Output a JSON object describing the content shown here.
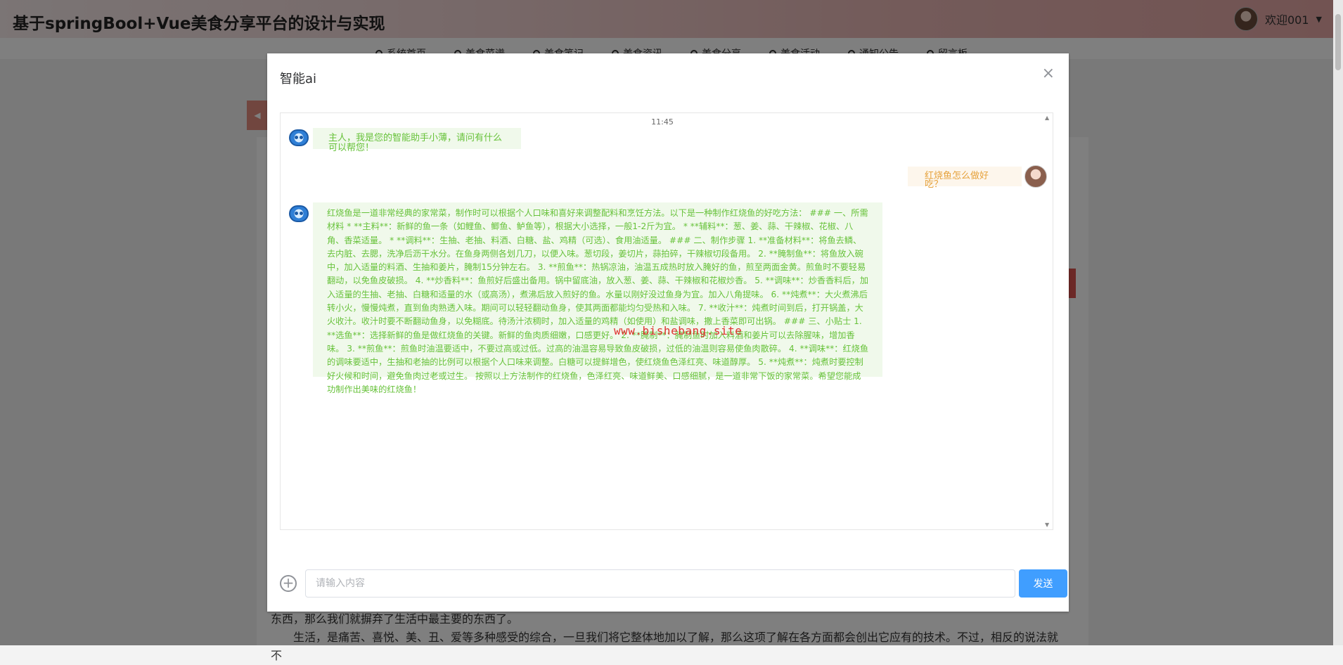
{
  "header": {
    "site_title": "基于springBool+Vue美食分享平台的设计与实现",
    "welcome": "欢迎001",
    "caret": "▼"
  },
  "nav": {
    "items": [
      "系统首页",
      "美食菜谱",
      "美食笔记",
      "美食资讯",
      "美食分享",
      "美食活动",
      "通知公告",
      "留言板"
    ]
  },
  "article": {
    "lines": [
      "东西，那么我们就摒弃了生活中最主要的东西了。",
      "生活，是痛苦、喜悦、美、丑、爱等多种感受的综合，一旦我们将它整体地加以了解，那么这项了解在各方面都会创出它应有的技术。不过，相反的说法就不"
    ]
  },
  "dialog": {
    "title": "智能ai",
    "close_glyph": "×",
    "timestamp": "11:45",
    "messages": [
      {
        "role": "bot",
        "text": "主人，我是您的智能助手小薄，请问有什么可以帮您！"
      },
      {
        "role": "user",
        "text": "红烧鱼怎么做好吃？"
      },
      {
        "role": "bot",
        "text": "红烧鱼是一道非常经典的家常菜，制作时可以根据个人口味和喜好来调整配料和烹饪方法。以下是一种制作红烧鱼的好吃方法： ### 一、所需材料 * **主料**：新鲜的鱼一条（如鲤鱼、鲫鱼、鲈鱼等），根据大小选择，一般1-2斤为宜。 * **辅料**：葱、姜、蒜、干辣椒、花椒、八角、香菜适量。 * **调料**：生抽、老抽、料酒、白糖、盐、鸡精（可选）、食用油适量。 ### 二、制作步骤 1. **准备材料**：将鱼去鳞、去内脏、去腮，洗净后沥干水分。在鱼身两侧各划几刀，以便入味。葱切段，姜切片，蒜拍碎，干辣椒切段备用。 2. **腌制鱼**：将鱼放入碗中，加入适量的料酒、生抽和姜片，腌制15分钟左右。 3. **煎鱼**：热锅凉油，油温五成热时放入腌好的鱼，煎至两面金黄。煎鱼时不要轻易翻动，以免鱼皮破损。 4. **炒香料**：鱼煎好后盛出备用。锅中留底油，放入葱、姜、蒜、干辣椒和花椒炒香。 5. **调味**：炒香香料后，加入适量的生抽、老抽、白糖和适量的水（或高汤），煮沸后放入煎好的鱼。水量以刚好没过鱼身为宜。加入八角提味。 6. **炖煮**：大火煮沸后转小火，慢慢炖煮，直到鱼肉熟透入味。期间可以轻轻翻动鱼身，使其两面都能均匀受热和入味。 7. **收汁**：炖煮时间到后，打开锅盖，大火收汁。收汁时要不断翻动鱼身，以免糊底。待汤汁浓稠时，加入适量的鸡精（如使用）和盐调味，撒上香菜即可出锅。 ### 三、小贴士 1. **选鱼**：选择新鲜的鱼是做红烧鱼的关键。新鲜的鱼肉质细嫩，口感更好。 2. **腌制**：腌制鱼时加入料酒和姜片可以去除腥味，增加香味。 3. **煎鱼**：煎鱼时油温要适中，不要过高或过低。过高的油温容易导致鱼皮破损，过低的油温则容易使鱼肉散碎。 4. **调味**：红烧鱼的调味要适中，生抽和老抽的比例可以根据个人口味来调整。白糖可以提鲜增色，使红烧鱼色泽红亮、味道醇厚。 5. **炖煮**：炖煮时要控制好火候和时间，避免鱼肉过老或过生。 按照以上方法制作的红烧鱼，色泽红亮、味道鲜美、口感细腻，是一道非常下饭的家常菜。希望您能成功制作出美味的红烧鱼！"
      }
    ],
    "watermark": "www.bishebang.site",
    "input": {
      "value": "",
      "placeholder": "请输入内容"
    },
    "plus_glyph": "+",
    "send_label": "发送",
    "scroll_up": "▲",
    "scroll_down": "▼"
  },
  "colors": {
    "bot_bubble_bg": "#f0f9eb",
    "bot_text": "#67c23a",
    "user_bubble_bg": "#fdf6ec",
    "user_text": "#e6a23c",
    "primary": "#409eff"
  }
}
